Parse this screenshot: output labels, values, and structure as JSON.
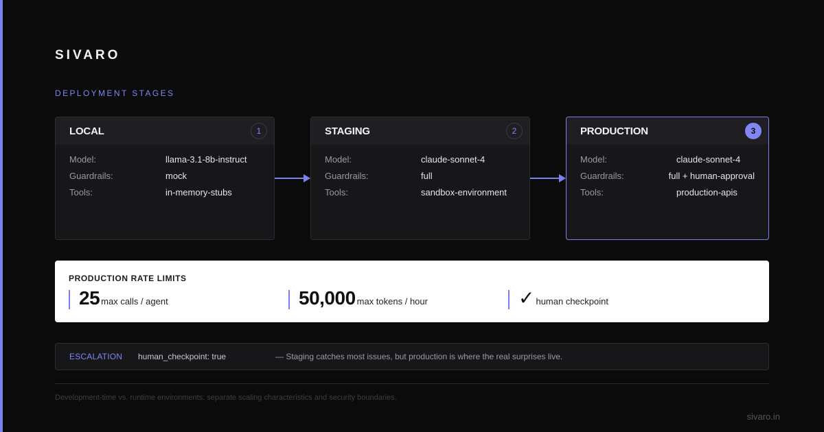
{
  "brand": "SIVARO",
  "section_label": "DEPLOYMENT STAGES",
  "colors": {
    "accent": "#7b82f0",
    "background": "#0b0b0c",
    "card": "#17171a"
  },
  "stages": [
    {
      "title": "LOCAL",
      "number": "1",
      "rows": [
        {
          "key": "Model:",
          "value": "llama-3.1-8b-instruct"
        },
        {
          "key": "Guardrails:",
          "value": "mock"
        },
        {
          "key": "Tools:",
          "value": "in-memory-stubs"
        }
      ]
    },
    {
      "title": "STAGING",
      "number": "2",
      "rows": [
        {
          "key": "Model:",
          "value": "claude-sonnet-4"
        },
        {
          "key": "Guardrails:",
          "value": "full"
        },
        {
          "key": "Tools:",
          "value": "sandbox-environment"
        }
      ]
    },
    {
      "title": "PRODUCTION",
      "number": "3",
      "rows": [
        {
          "key": "Model:",
          "value": "claude-sonnet-4"
        },
        {
          "key": "Guardrails:",
          "value": "full + human-approval"
        },
        {
          "key": "Tools:",
          "value": "production-apis"
        }
      ]
    }
  ],
  "limits": {
    "title": "PRODUCTION RATE LIMITS",
    "items": [
      {
        "value": "25",
        "label": "max calls / agent"
      },
      {
        "value": "50,000",
        "label": "max tokens / hour"
      },
      {
        "value": "✓",
        "label": "human checkpoint"
      }
    ]
  },
  "escalation": {
    "label": "ESCALATION",
    "code": "human_checkpoint: true",
    "note": "— Staging catches most issues, but production is where the real surprises live."
  },
  "footnote": "Development-time vs. runtime environments: separate scaling characteristics and security boundaries.",
  "site": "sivaro.in"
}
